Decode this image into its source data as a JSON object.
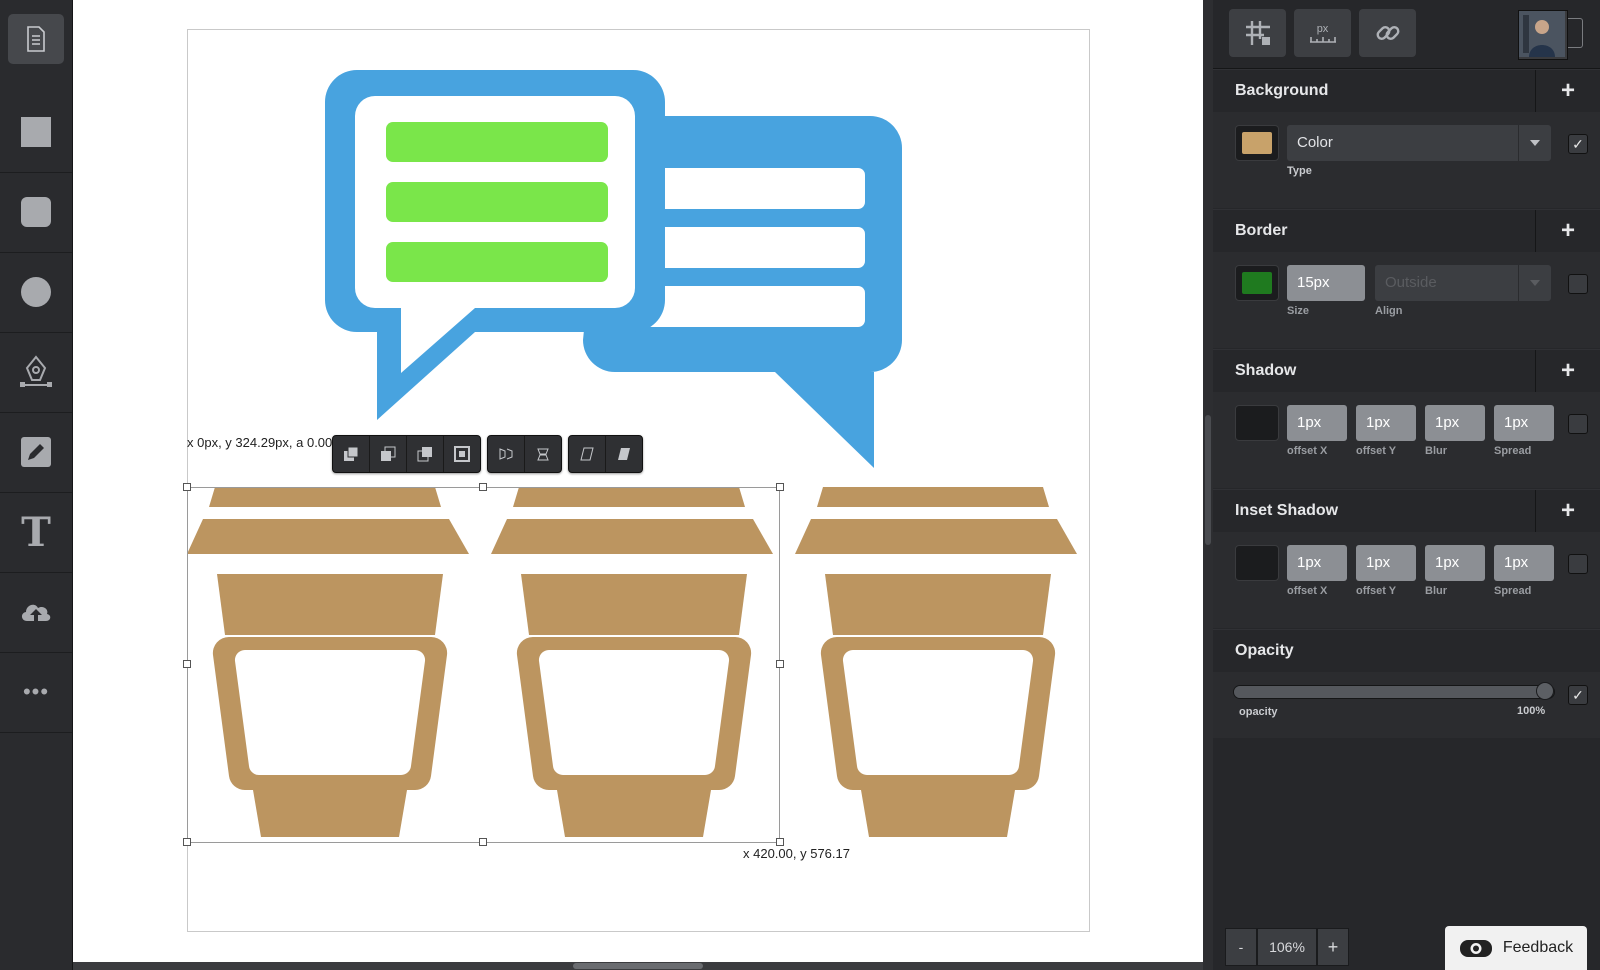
{
  "toolbar": {
    "items": [
      "document-icon",
      "rectangle-icon",
      "rounded-rectangle-icon",
      "ellipse-icon",
      "pen-tool-icon",
      "pencil-icon",
      "text-icon",
      "upload-icon",
      "more-icon"
    ],
    "text_glyph": "T",
    "more_glyph": "•••"
  },
  "canvas": {
    "top_coord": "x 0px, y 324.29px, a 0.00",
    "bottom_coord": "x 420.00, y 576.17",
    "colors": {
      "blue": "#48a3df",
      "green": "#7ae64a",
      "cup": "#bc9560",
      "white": "#ffffff"
    }
  },
  "context_toolbar": {
    "groups": [
      [
        "bring-to-front-icon",
        "bring-forward-icon",
        "send-backward-icon",
        "send-to-back-icon"
      ],
      [
        "flip-horizontal-icon",
        "flip-vertical-icon"
      ],
      [
        "skew-left-icon",
        "skew-right-icon"
      ]
    ]
  },
  "panel": {
    "top_buttons": {
      "grid_icon": "grid-icon",
      "units_label": "px",
      "link_icon": "link-icon"
    },
    "background": {
      "title": "Background",
      "plus": "+",
      "color": "#c8a26a",
      "type_value": "Color",
      "type_label": "Type",
      "checked": "✓"
    },
    "border": {
      "title": "Border",
      "plus": "+",
      "color": "#1f7a1f",
      "size_value": "15px",
      "size_label": "Size",
      "align_value": "Outside",
      "align_label": "Align"
    },
    "shadow": {
      "title": "Shadow",
      "plus": "+",
      "values": [
        "1px",
        "1px",
        "1px",
        "1px"
      ],
      "labels": [
        "offset X",
        "offset Y",
        "Blur",
        "Spread"
      ]
    },
    "inset_shadow": {
      "title": "Inset Shadow",
      "plus": "+",
      "values": [
        "1px",
        "1px",
        "1px",
        "1px"
      ],
      "labels": [
        "offset X",
        "offset Y",
        "Blur",
        "Spread"
      ]
    },
    "opacity": {
      "title": "Opacity",
      "label": "opacity",
      "value_text": "100%",
      "value": 1.0,
      "checked": "✓"
    },
    "zoom": {
      "minus": "-",
      "value": "106%",
      "plus": "+"
    },
    "feedback": "Feedback"
  }
}
